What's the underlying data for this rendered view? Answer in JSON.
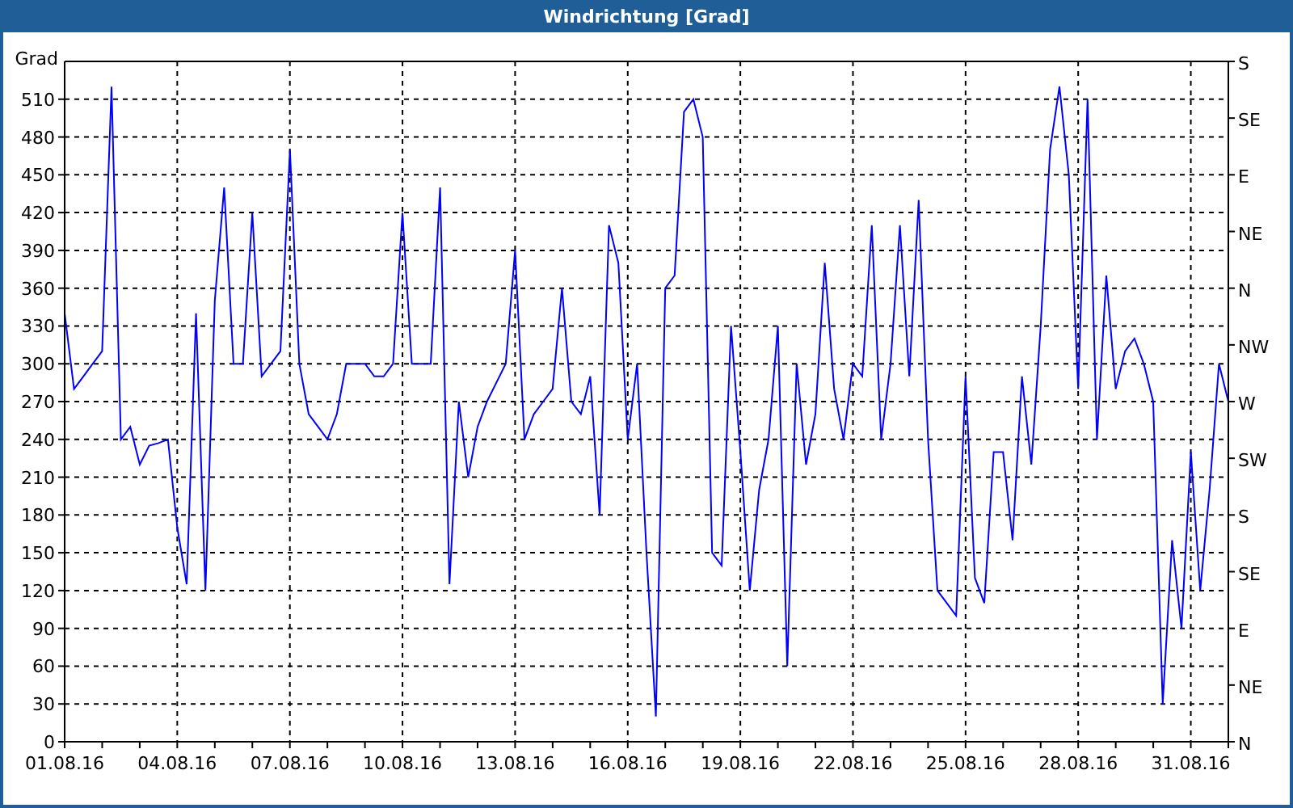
{
  "window": {
    "title": "Windrichtung [Grad]"
  },
  "chart": {
    "right_axis_labels": [
      "S",
      "SE",
      "E",
      "NE",
      "N",
      "NW",
      "W",
      "SW",
      "S",
      "SE",
      "E",
      "NE",
      "N"
    ],
    "chart_data": {
      "type": "line",
      "ylabel": "Grad",
      "grid": true,
      "categories": [
        "01.08.16",
        null,
        null,
        null,
        null,
        null,
        null,
        null,
        null,
        null,
        null,
        null,
        "04.08.16",
        null,
        null,
        null,
        null,
        null,
        null,
        null,
        null,
        null,
        null,
        null,
        "07.08.16",
        null,
        null,
        null,
        null,
        null,
        null,
        null,
        null,
        null,
        null,
        null,
        "10.08.16",
        null,
        null,
        null,
        null,
        null,
        null,
        null,
        null,
        null,
        null,
        null,
        "13.08.16",
        null,
        null,
        null,
        null,
        null,
        null,
        null,
        null,
        null,
        null,
        null,
        "16.08.16",
        null,
        null,
        null,
        null,
        null,
        null,
        null,
        null,
        null,
        null,
        null,
        "19.08.16",
        null,
        null,
        null,
        null,
        null,
        null,
        null,
        null,
        null,
        null,
        null,
        "22.08.16",
        null,
        null,
        null,
        null,
        null,
        null,
        null,
        null,
        null,
        null,
        null,
        "25.08.16",
        null,
        null,
        null,
        null,
        null,
        null,
        null,
        null,
        null,
        null,
        null,
        "28.08.16",
        null,
        null,
        null,
        null,
        null,
        null,
        null,
        null,
        null,
        null,
        null,
        "31.08.16",
        null,
        null,
        null,
        null
      ],
      "series": [
        {
          "color": "#0000ff",
          "values": [
            340,
            280,
            290,
            300,
            310,
            520,
            240,
            250,
            220,
            235,
            237,
            240,
            170,
            125,
            340,
            120,
            350,
            440,
            300,
            300,
            420,
            290,
            300,
            310,
            470,
            300,
            260,
            250,
            240,
            260,
            300,
            300,
            300,
            290,
            290,
            300,
            420,
            300,
            300,
            300,
            440,
            125,
            270,
            210,
            250,
            270,
            285,
            300,
            390,
            240,
            260,
            270,
            280,
            360,
            270,
            260,
            290,
            180,
            410,
            380,
            240,
            300,
            150,
            20,
            360,
            370,
            500,
            510,
            480,
            150,
            140,
            330,
            230,
            120,
            200,
            240,
            330,
            60,
            300,
            220,
            260,
            380,
            280,
            240,
            300,
            290,
            410,
            240,
            300,
            410,
            290,
            430,
            240,
            120,
            110,
            100,
            290,
            130,
            110,
            230,
            230,
            160,
            290,
            220,
            330,
            470,
            520,
            450,
            280,
            510,
            240,
            370,
            280,
            310,
            320,
            300,
            270,
            30,
            160,
            90,
            230,
            120,
            200,
            300,
            270
          ]
        }
      ],
      "ylim": [
        0,
        540
      ],
      "yticks": [
        0,
        30,
        60,
        90,
        120,
        150,
        180,
        210,
        240,
        270,
        300,
        330,
        360,
        390,
        420,
        450,
        480,
        510
      ]
    }
  }
}
